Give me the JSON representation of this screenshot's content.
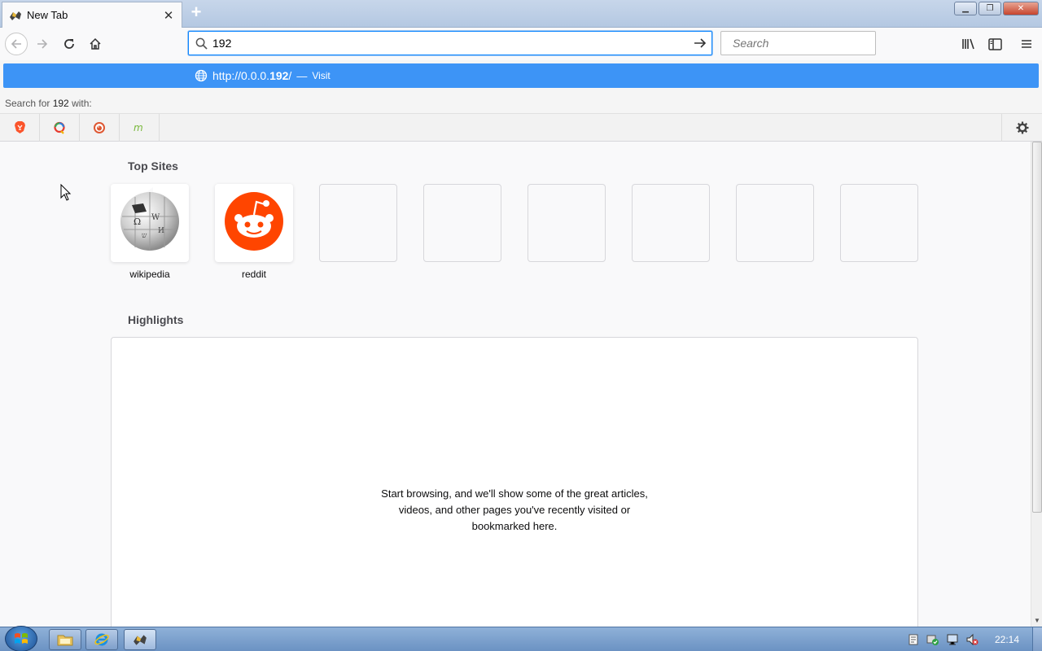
{
  "tab": {
    "title": "New Tab"
  },
  "navbar": {
    "url_value": "192",
    "search_placeholder": "Search"
  },
  "popup": {
    "visit_url_prefix": "http://0.0.0.",
    "visit_url_bold": "192",
    "visit_url_suffix": "/",
    "visit_separator": "—",
    "visit_action": "Visit",
    "search_for_prefix": "Search for",
    "search_for_term": "192",
    "search_for_suffix": "with:",
    "engines": [
      "brave-icon",
      "qwant-icon",
      "duckduckgo-icon",
      "mojeek-icon"
    ]
  },
  "top_sites": {
    "title": "Top Sites",
    "tiles": [
      {
        "label": "wikipedia",
        "icon": "wikipedia-globe-icon"
      },
      {
        "label": "reddit",
        "icon": "reddit-alien-icon"
      }
    ]
  },
  "highlights": {
    "title": "Highlights",
    "empty_line1": "Start browsing, and we'll show some of the great articles,",
    "empty_line2": "videos, and other pages you've recently visited or",
    "empty_line3": "bookmarked here."
  },
  "taskbar": {
    "clock": "22:14"
  },
  "colors": {
    "accent": "#0a84ff",
    "visit_row": "#3d94f6",
    "reddit": "#ff4500"
  }
}
